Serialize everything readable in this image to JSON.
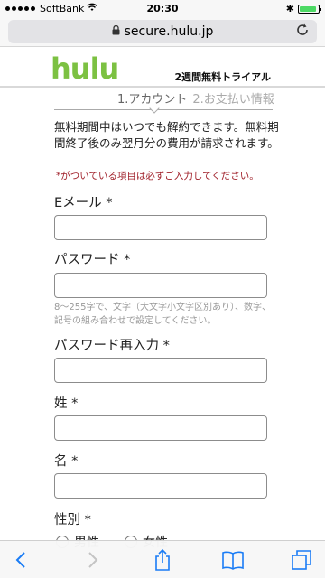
{
  "status_bar": {
    "carrier": "SoftBank",
    "time": "20:30",
    "battery_level": 0.9
  },
  "browser": {
    "url": "secure.hulu.jp"
  },
  "header": {
    "logo": "hulu",
    "trial_label": "2週間無料トライアル"
  },
  "steps": {
    "step1": "1.アカウント",
    "step2": "2.お支払い情報"
  },
  "info": {
    "text": "無料期間中はいつでも解約できます。無料期間終了後のみ翌月分の費用が請求されます。",
    "required_note": "*がついている項目は必ずご入力してください。"
  },
  "form": {
    "email_label": "Eメール *",
    "password_label": "パスワード *",
    "password_hint": "8～255字で、文字（大文字小文字区別あり）、数字、記号の組み合わせで設定してください。",
    "password_confirm_label": "パスワード再入力 *",
    "last_name_label": "姓 *",
    "first_name_label": "名 *",
    "gender_label": "性別 *",
    "gender_options": [
      "男性",
      "女性"
    ]
  },
  "colors": {
    "brand_green": "#7cc142",
    "ios_blue": "#1a7cf5",
    "required_red": "#a0202a"
  }
}
